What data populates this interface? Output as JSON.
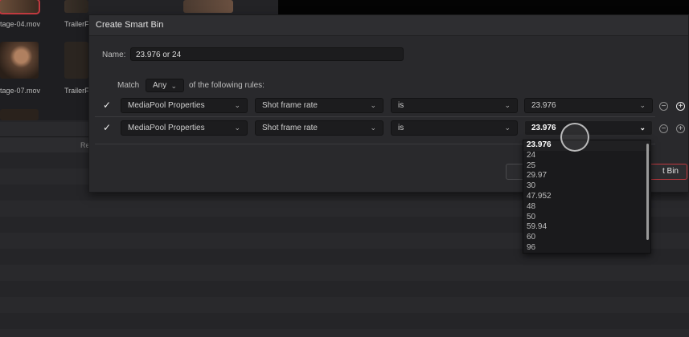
{
  "media_pool": {
    "clips": [
      {
        "name": "tage-04.mov"
      },
      {
        "name": "TrailerF"
      },
      {
        "name": "tage-07.mov"
      },
      {
        "name": "TrailerF"
      }
    ],
    "column_label": "Re"
  },
  "dialog": {
    "title": "Create Smart Bin",
    "name_label": "Name:",
    "name_value": "23.976 or 24",
    "match_label": "Match",
    "match_value": "Any",
    "match_suffix": "of the following rules:",
    "rules": [
      {
        "property": "MediaPool Properties",
        "field": "Shot frame rate",
        "operator": "is",
        "value": "23.976"
      },
      {
        "property": "MediaPool Properties",
        "field": "Shot frame rate",
        "operator": "is",
        "value": "23.976"
      }
    ],
    "create_button_visible_text": "t Bin",
    "dropdown_options": [
      "23.976",
      "24",
      "25",
      "29.97",
      "30",
      "47.952",
      "48",
      "50",
      "59.94",
      "60",
      "96"
    ]
  },
  "colors": {
    "accent_red": "#c0393f",
    "dialog_bg": "#29292c",
    "field_bg": "#1c1c1e"
  },
  "icons": {
    "check": "check-icon",
    "chevron": "chevron-down-icon",
    "remove": "minus-circle-icon",
    "add": "plus-circle-icon"
  }
}
